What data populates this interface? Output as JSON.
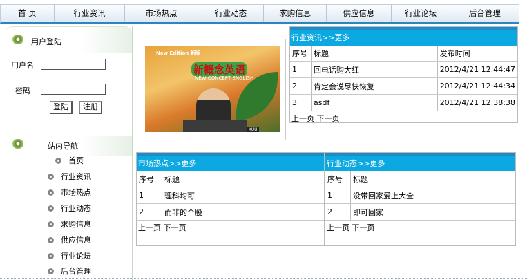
{
  "nav": [
    "首 页",
    "行业资讯",
    "市场热点",
    "行业动态",
    "求购信息",
    "供应信息",
    "行业论坛",
    "后台管理"
  ],
  "login": {
    "title": "用户登陆",
    "username_label": "用户名",
    "password_label": "密码",
    "login_button": "登陆",
    "register_button": "注册"
  },
  "station_nav": {
    "title": "站内导航",
    "items": [
      "首页",
      "行业资讯",
      "市场热点",
      "行业动态",
      "求购信息",
      "供应信息",
      "行业论坛",
      "后台管理"
    ]
  },
  "video": {
    "brand": "New Edition 新版",
    "headline": "新概念英语",
    "subline": "NEW CONCEPT ENGLISH",
    "logo": "KUU"
  },
  "industry_news": {
    "header": "行业资讯>>更多",
    "columns": [
      "序号",
      "标题",
      "发布时间"
    ],
    "rows": [
      [
        "1",
        "回电话购大红",
        "2012/4/21 12:44:47"
      ],
      [
        "2",
        "肯定会说尽快恢复",
        "2012/4/21 12:44:34"
      ],
      [
        "3",
        "asdf",
        "2012/4/21 12:38:38"
      ]
    ],
    "pager": "上一页 下一页"
  },
  "market_hot": {
    "header": "市场热点>>更多",
    "columns": [
      "序号",
      "标题"
    ],
    "rows": [
      [
        "1",
        "理科均可"
      ],
      [
        "2",
        "而非的个股"
      ]
    ],
    "pager": "上一页 下一页"
  },
  "industry_trends": {
    "header": "行业动态>>更多",
    "columns": [
      "序号",
      "标题"
    ],
    "rows": [
      [
        "1",
        "没带回家爱上大全"
      ],
      [
        "2",
        "即可回家"
      ]
    ],
    "pager": "上一页 下一页"
  },
  "colors": {
    "accent_bar": "#0ca8e2",
    "nav_border": "#2a86c2"
  }
}
